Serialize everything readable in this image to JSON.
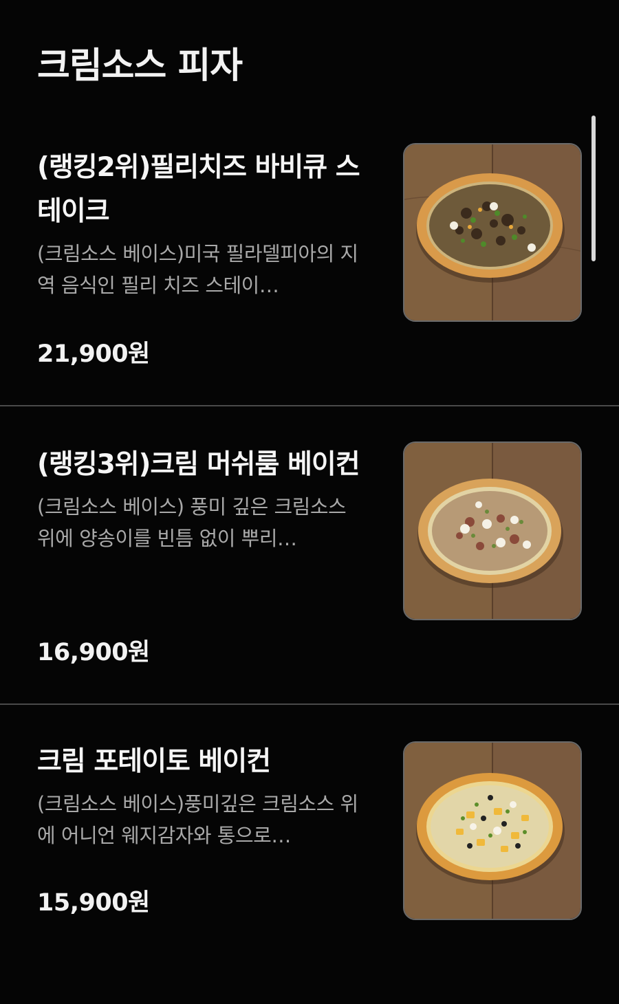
{
  "section": {
    "title": "크림소스 피자"
  },
  "items": [
    {
      "name": "(랭킹2위)필리치즈 바비큐 스테이크",
      "description": "(크림소스 베이스)미국 필라델피아의 지역 음식인 필리 치즈 스테이…",
      "price": "21,900원"
    },
    {
      "name": "(랭킹3위)크림 머쉬룸 베이컨",
      "description": "(크림소스 베이스) 풍미 깊은 크림소스 위에 양송이를 빈틈 없이 뿌리…",
      "price": "16,900원"
    },
    {
      "name": "크림 포테이토 베이컨",
      "description": "(크림소스 베이스)풍미깊은 크림소스 위에 어니언 웨지감자와 통으로…",
      "price": "15,900원"
    }
  ],
  "colors": {
    "background": "#050505",
    "text_primary": "#f5f5f5",
    "text_secondary": "#a9a9a9",
    "divider": "#4a4a4a"
  }
}
